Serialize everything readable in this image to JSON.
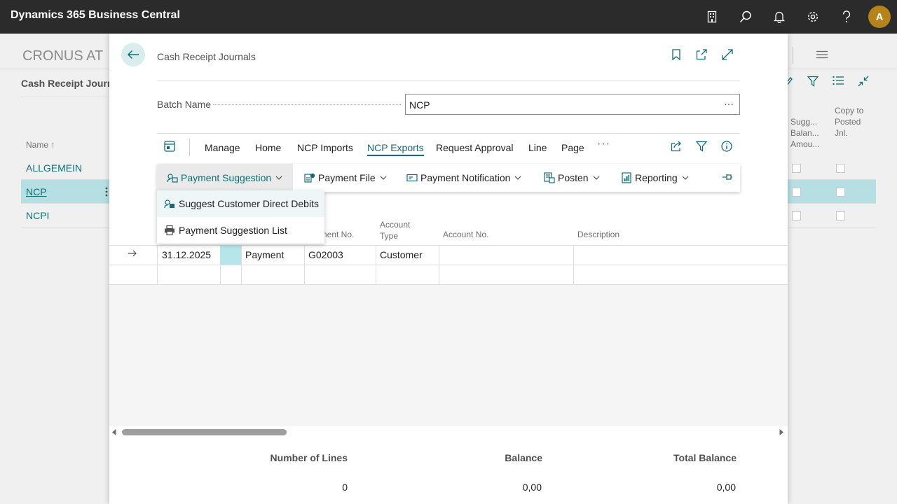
{
  "app": {
    "title": "Dynamics 365 Business Central",
    "user_initial": "A"
  },
  "topbar_icons": [
    "building-icon",
    "search-icon",
    "bell-icon",
    "gear-icon",
    "help-icon"
  ],
  "background": {
    "company": "CRONUS AT",
    "page_title": "Cash Receipt Journa",
    "column_name": "Name ↑",
    "rows": [
      "ALLGEMEIN",
      "NCP",
      "NCPI"
    ],
    "right_columns": [
      "Sugg... Balan... Amou...",
      "Copy to Posted Jnl."
    ]
  },
  "dialog": {
    "title": "Cash Receipt Journals",
    "batch_label": "Batch Name",
    "batch_value": "NCP",
    "more_label": "···",
    "tabs": [
      "Manage",
      "Home",
      "NCP Imports",
      "NCP Exports",
      "Request Approval",
      "Line",
      "Page"
    ],
    "tabs_more": "···",
    "sub_actions": [
      "Payment Suggestion",
      "Payment File",
      "Payment Notification",
      "Posten",
      "Reporting"
    ],
    "dropdown_items": [
      "Suggest Customer Direct Debits",
      "Payment Suggestion List"
    ],
    "columns": {
      "document_no": "ument No.",
      "account_type_1": "Account",
      "account_type_2": "Type",
      "account_no": "Account No.",
      "description": "Description"
    },
    "row": {
      "date": "31.12.2025",
      "doc_type": "Payment",
      "doc_no": "G02003",
      "account_type": "Customer",
      "account_no": "",
      "description": ""
    },
    "totals": {
      "lines_label": "Number of Lines",
      "lines_value": "0",
      "balance_label": "Balance",
      "balance_value": "0,00",
      "total_label": "Total Balance",
      "total_value": "0,00"
    }
  },
  "colors": {
    "accent": "#0f6e75",
    "topbar": "#2b2b2b",
    "avatar": "#b5821b",
    "selected_row": "#b6dfe3"
  }
}
